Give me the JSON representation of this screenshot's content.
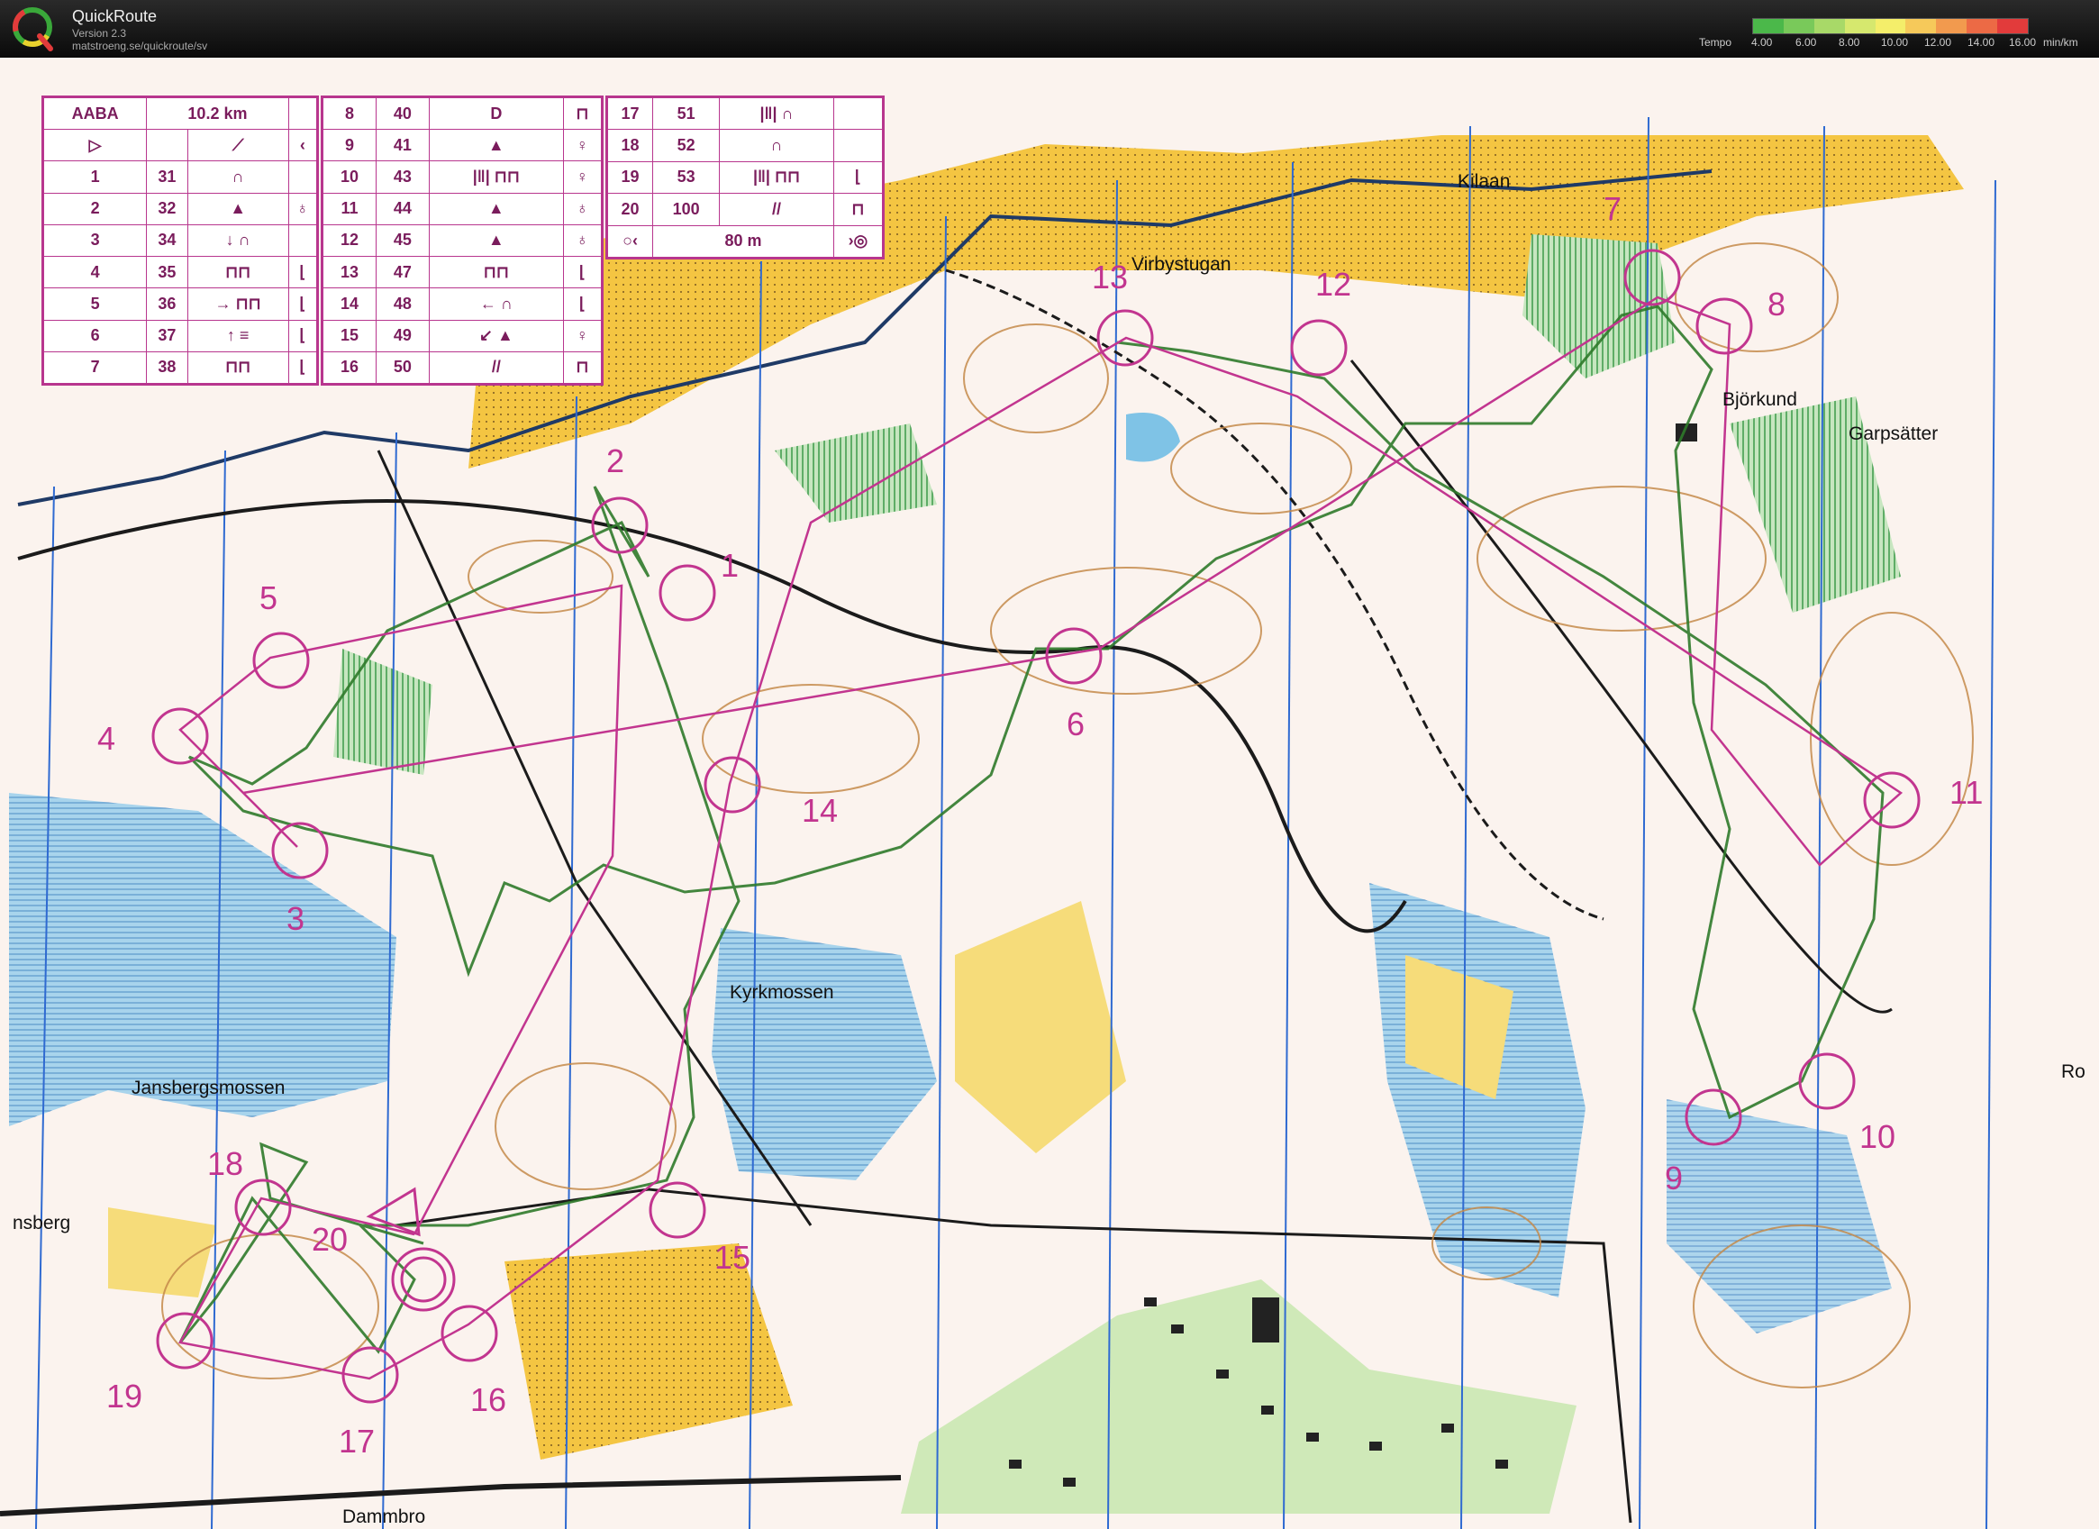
{
  "app": {
    "name": "QuickRoute",
    "version": "Version 2.3",
    "url": "matstroeng.se/quickroute/sv"
  },
  "legend": {
    "label": "Tempo",
    "ticks": [
      "4.00",
      "6.00",
      "8.00",
      "10.00",
      "12.00",
      "14.00",
      "16.00"
    ],
    "unit": "min/km",
    "colors": [
      "#4bb84a",
      "#79c95a",
      "#a8d968",
      "#d6e86e",
      "#f4ee6a",
      "#f6c95a",
      "#f29a4e",
      "#ec6a45",
      "#e23b3b"
    ]
  },
  "course": {
    "name": "AABA",
    "length": "10.2 km",
    "finish_distance": "80 m",
    "legs_a": [
      {
        "n": "1",
        "code": "31"
      },
      {
        "n": "2",
        "code": "32"
      },
      {
        "n": "3",
        "code": "34"
      },
      {
        "n": "4",
        "code": "35"
      },
      {
        "n": "5",
        "code": "36"
      },
      {
        "n": "6",
        "code": "37"
      },
      {
        "n": "7",
        "code": "38"
      }
    ],
    "legs_b": [
      {
        "n": "8",
        "code": "40"
      },
      {
        "n": "9",
        "code": "41"
      },
      {
        "n": "10",
        "code": "43"
      },
      {
        "n": "11",
        "code": "44"
      },
      {
        "n": "12",
        "code": "45"
      },
      {
        "n": "13",
        "code": "47"
      },
      {
        "n": "14",
        "code": "48"
      },
      {
        "n": "15",
        "code": "49"
      },
      {
        "n": "16",
        "code": "50"
      }
    ],
    "legs_c": [
      {
        "n": "17",
        "code": "51"
      },
      {
        "n": "18",
        "code": "52"
      },
      {
        "n": "19",
        "code": "53"
      },
      {
        "n": "20",
        "code": "100"
      }
    ]
  },
  "places": {
    "kilaan": "Kilaan",
    "virbystugan": "Virbystugan",
    "bjorkund": "Björkund",
    "garpsatter": "Garpsätter",
    "kyrkmossen": "Kyrkmossen",
    "jansbergsmossen": "Jansbergsmossen",
    "nsberg": "nsberg",
    "ro": "Ro",
    "dammbro": "Dammbro"
  },
  "controls": [
    "1",
    "2",
    "3",
    "4",
    "5",
    "6",
    "7",
    "8",
    "9",
    "10",
    "11",
    "12",
    "13",
    "14",
    "15",
    "16",
    "17",
    "18",
    "19",
    "20"
  ],
  "colors": {
    "course": "#c2358f",
    "route": "#2f7a2a",
    "water": "#7fc3e6",
    "open": "#f4c542",
    "forest": "#fbf3ee",
    "contour": "#c48a4a",
    "meridian": "#2f6ad1"
  }
}
